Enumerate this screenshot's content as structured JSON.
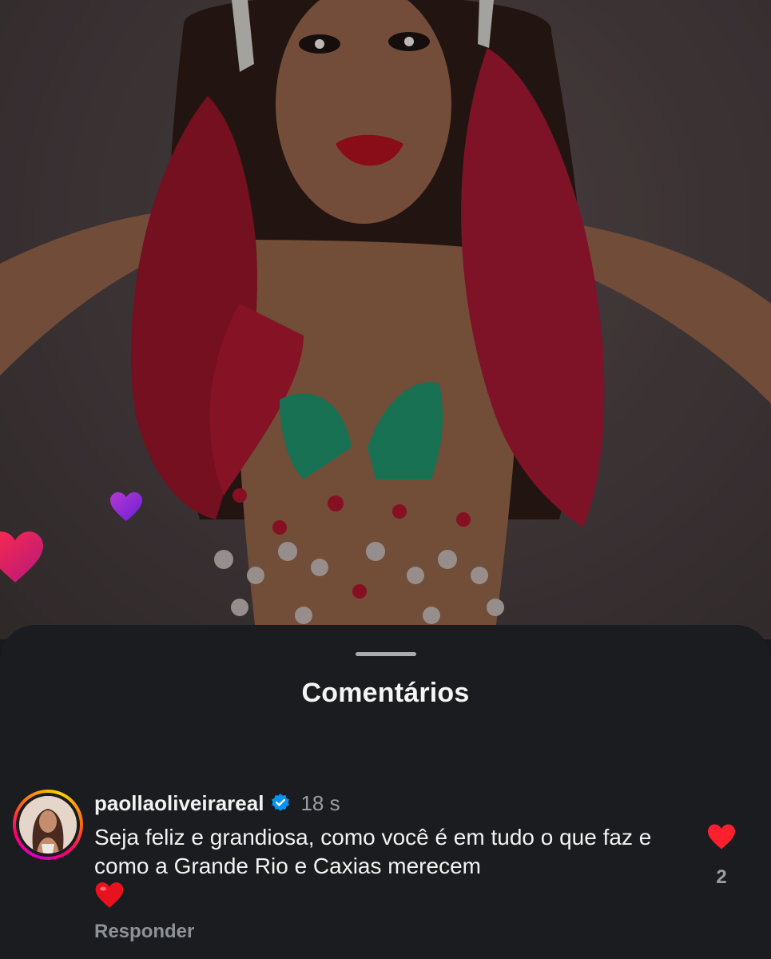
{
  "background": {
    "icon": "live-portrait-photo"
  },
  "sheet": {
    "title": "Comentários"
  },
  "comment": {
    "username": "paollaoliveirareal",
    "verified_icon": "verified-badge-icon",
    "timestamp": "18 s",
    "text": "Seja feliz e grandiosa, como você é em tudo o que faz e como a Grande Rio e Caxias merecem",
    "emoji": "red-heart-emoji",
    "reply_label": "Responder",
    "like_icon": "heart-icon",
    "like_count": "2",
    "liked": true
  },
  "colors": {
    "sheet_bg": "#1a1c1f",
    "like_red": "#ff1f2d",
    "verified_blue": "#0095f6",
    "muted_text": "#9a9da1"
  }
}
